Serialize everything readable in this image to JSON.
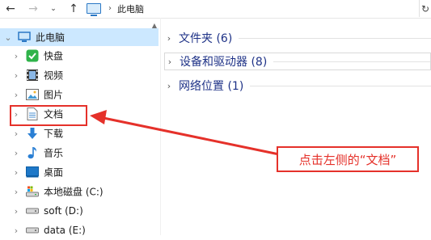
{
  "nav": {
    "back_icon": "arrow-left-icon",
    "forward_icon": "arrow-right-icon",
    "history_icon": "chevron-down-icon",
    "up_icon": "arrow-up-icon",
    "breadcrumb": [
      "此电脑"
    ],
    "refresh_icon": "refresh-icon"
  },
  "sidebar": {
    "root": {
      "label": "此电脑",
      "icon": "computer-icon"
    },
    "items": [
      {
        "label": "快盘",
        "icon": "kuaipan-icon"
      },
      {
        "label": "视频",
        "icon": "video-icon"
      },
      {
        "label": "图片",
        "icon": "pictures-icon"
      },
      {
        "label": "文档",
        "icon": "documents-icon"
      },
      {
        "label": "下载",
        "icon": "download-icon"
      },
      {
        "label": "音乐",
        "icon": "music-icon"
      },
      {
        "label": "桌面",
        "icon": "desktop-icon"
      },
      {
        "label": "本地磁盘 (C:)",
        "icon": "drive-c-icon"
      },
      {
        "label": "soft (D:)",
        "icon": "drive-d-icon"
      },
      {
        "label": "data (E:)",
        "icon": "drive-e-icon"
      }
    ]
  },
  "main": {
    "groups": [
      {
        "title": "文件夹 (6)"
      },
      {
        "title": "设备和驱动器 (8)"
      },
      {
        "title": "网络位置 (1)"
      }
    ]
  },
  "annotation": {
    "text": "点击左侧的“文档”",
    "color": "#e5312a"
  }
}
